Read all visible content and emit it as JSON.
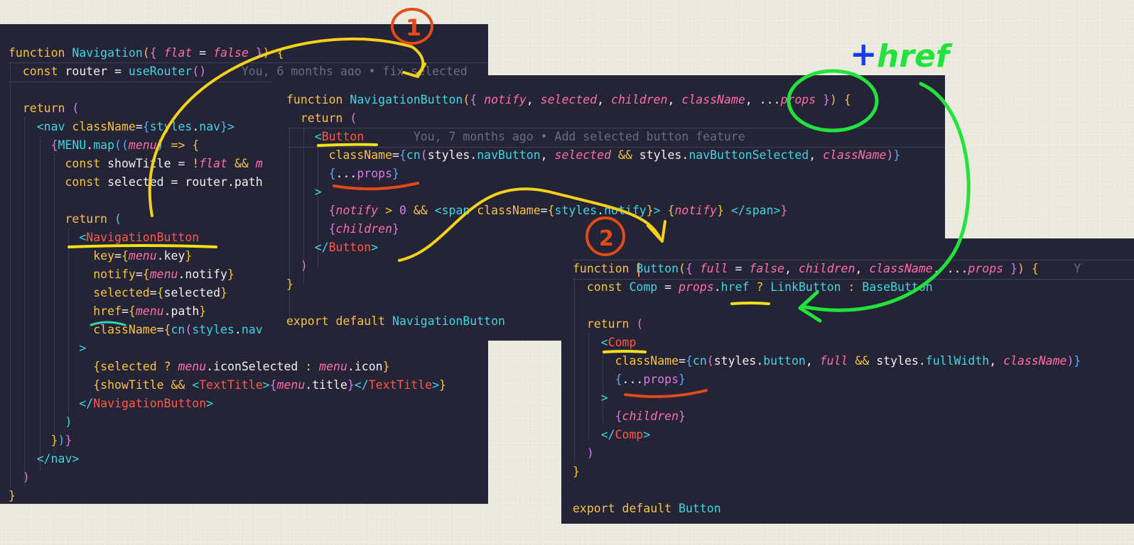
{
  "panel1": {
    "lines": [
      "function Navigation({ flat = false }) {",
      "  const router = useRouter()     You, 6 months ago • fix selected",
      "",
      "  return (",
      "    <nav className={styles.nav}>",
      "      {MENU.map((menu) => {",
      "        const showTitle = !flat && m",
      "        const selected = router.path",
      "",
      "        return (",
      "          <NavigationButton",
      "            key={menu.key}",
      "            notify={menu.notify}",
      "            selected={selected}",
      "            href={menu.path}",
      "            className={cn(styles.nav",
      "          >",
      "            {selected ? menu.iconSelected : menu.icon}",
      "            {showTitle && <TextTitle>{menu.title}</TextTitle>}",
      "          </NavigationButton>",
      "        )",
      "      })}",
      "    </nav>",
      "  )",
      "}"
    ]
  },
  "panel2": {
    "lines": [
      "function NavigationButton({ notify, selected, children, className, ...props }) {",
      "  return (",
      "    <Button       You, 7 months ago • Add selected button feature",
      "      className={cn(styles.navButton, selected && styles.navButtonSelected, className)}",
      "      {...props}",
      "    >",
      "      {notify > 0 && <span className={styles.notify}> {notify} </span>}",
      "      {children}",
      "    </Button>",
      "  )",
      "}",
      "",
      "export default NavigationButton"
    ]
  },
  "panel3": {
    "lines": [
      "function Button({ full = false, children, className, ...props }) {     Y",
      "  const Comp = props.href ? LinkButton : BaseButton",
      "",
      "  return (",
      "    <Comp",
      "      className={cn(styles.button, full && styles.fullWidth, className)}",
      "      {...props}",
      "    >",
      "      {children}",
      "    </Comp>",
      "  )",
      "}",
      "",
      "export default Button"
    ]
  },
  "annotations": {
    "step1": "1",
    "step2": "2",
    "plus": "+",
    "href": "href"
  }
}
